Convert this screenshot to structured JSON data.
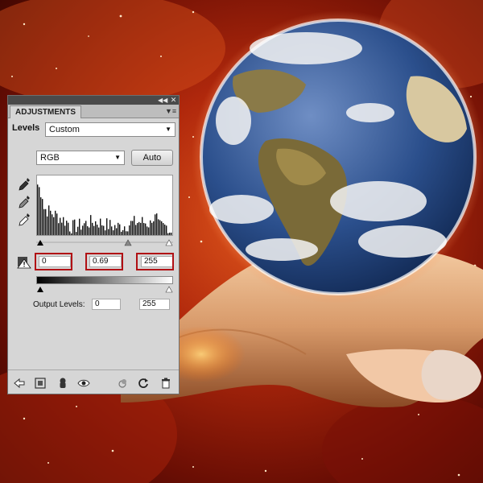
{
  "panel": {
    "tab_label": "ADJUSTMENTS",
    "adjustment_name": "Levels",
    "preset_value": "Custom",
    "channel_value": "RGB",
    "auto_label": "Auto",
    "input_levels": {
      "black": "0",
      "gamma": "0.69",
      "white": "255"
    },
    "output_label": "Output Levels:",
    "output_levels": {
      "black": "0",
      "white": "255"
    }
  },
  "icons": {
    "collapse": "double-chevron-icon",
    "close": "close-icon",
    "menu": "panel-menu-icon",
    "eyedroppers": [
      "black-point-eyedropper-icon",
      "gray-point-eyedropper-icon",
      "white-point-eyedropper-icon"
    ],
    "bottom": [
      "back-arrow-icon",
      "expand-view-icon",
      "clip-to-layer-icon",
      "visibility-eye-icon",
      "previous-state-icon",
      "reset-icon",
      "trash-icon"
    ]
  },
  "colors": {
    "highlight_box": "#b11014",
    "panel_bg": "#d6d6d6"
  }
}
